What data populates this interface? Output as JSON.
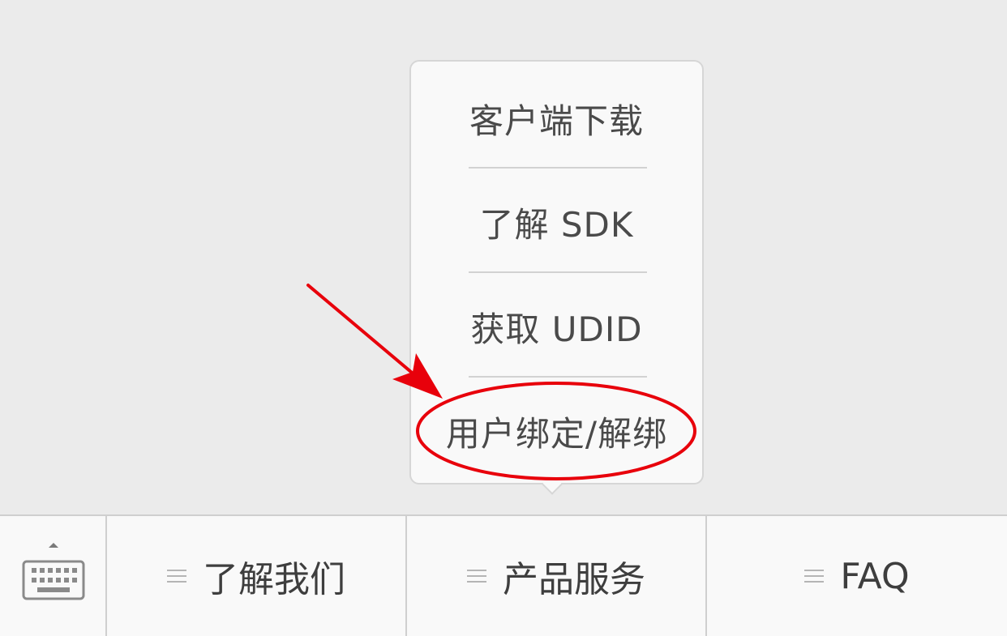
{
  "submenu": {
    "items": [
      {
        "label": "客户端下载"
      },
      {
        "label": "了解 SDK"
      },
      {
        "label": "获取 UDID"
      },
      {
        "label": "用户绑定/解绑"
      }
    ]
  },
  "annotation": {
    "highlight_color": "#e8000b",
    "highlighted_item": "用户绑定/解绑"
  },
  "menubar": {
    "keyboard_icon": "keyboard-icon",
    "tabs": [
      {
        "label": "了解我们",
        "icon": "hamburger-menu-icon"
      },
      {
        "label": "产品服务",
        "icon": "hamburger-menu-icon"
      },
      {
        "label": "FAQ",
        "icon": "hamburger-menu-icon"
      }
    ]
  }
}
